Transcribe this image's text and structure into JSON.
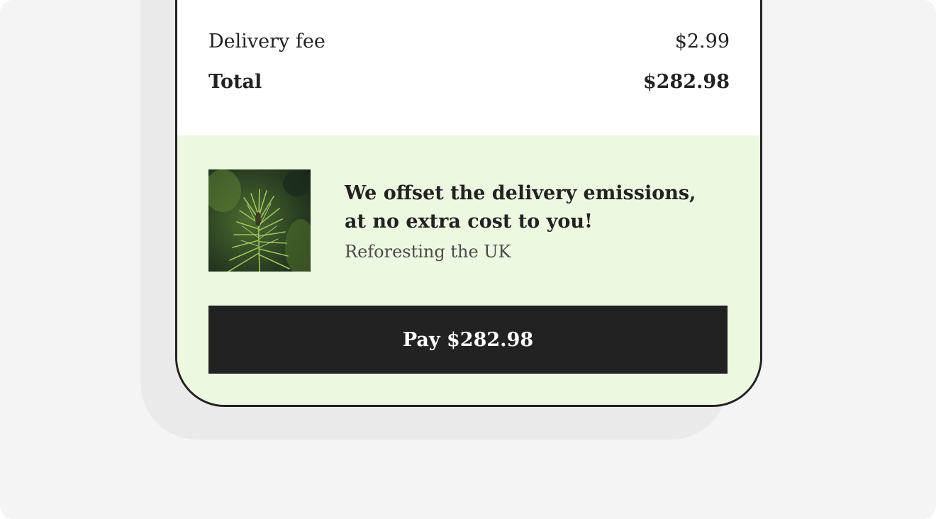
{
  "summary": {
    "delivery_fee_label": "Delivery fee",
    "delivery_fee_value": "$2.99",
    "total_label": "Total",
    "total_value": "$282.98"
  },
  "offset": {
    "image_icon": "pine-tree-photo",
    "heading_line1": "We offset the delivery emissions,",
    "heading_line2": "at no extra cost to you!",
    "subtext": "Reforesting the UK"
  },
  "pay_button": {
    "label": "Pay $282.98"
  },
  "colors": {
    "page_background": "#f4f4f4",
    "offset_background": "#edf8e1",
    "button_background": "#222222",
    "text_primary": "#222222"
  }
}
